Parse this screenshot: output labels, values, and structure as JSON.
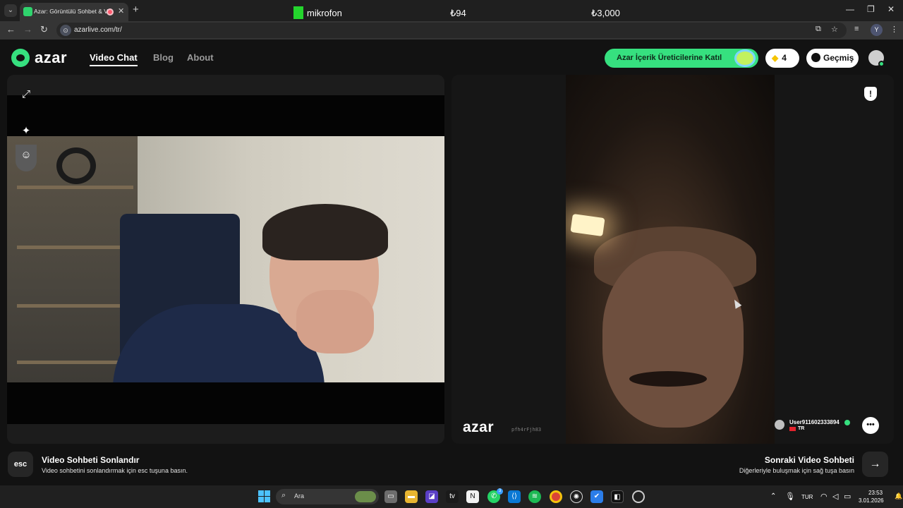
{
  "browser": {
    "tab_title": "Azar: Görüntülü Sohbet & V",
    "url": "azarlive.com/tr/",
    "profile_initial": "Y"
  },
  "overlay": {
    "mic_label": "mikrofon",
    "value_1": "₺94",
    "value_2": "₺3,000"
  },
  "header": {
    "logo_text": "azar",
    "nav": [
      {
        "label": "Video Chat",
        "active": true
      },
      {
        "label": "Blog",
        "active": false
      },
      {
        "label": "About",
        "active": false
      }
    ],
    "creator_button": "Azar İçerik Üreticilerine Katıl",
    "gems_count": "4",
    "history_button": "Geçmiş"
  },
  "remote": {
    "watermark": "azar",
    "watermark_id": "pfh4rFjh83",
    "peer_name": "User911602333894",
    "peer_country": "TR"
  },
  "footer": {
    "esc_key": "esc",
    "end_title": "Video Sohbeti Sonlandır",
    "end_desc": "Video sohbetini sonlandırmak için esc tuşuna basın.",
    "next_title": "Sonraki Video Sohbeti",
    "next_desc": "Diğerleriyle buluşmak için sağ tuşa basın"
  },
  "taskbar": {
    "search_placeholder": "Ara",
    "whatsapp_badge": "3",
    "language": "TUR",
    "time": "23:53",
    "date": "3.01.2026"
  },
  "colors": {
    "brand_green": "#36e07f",
    "background": "#121212"
  }
}
